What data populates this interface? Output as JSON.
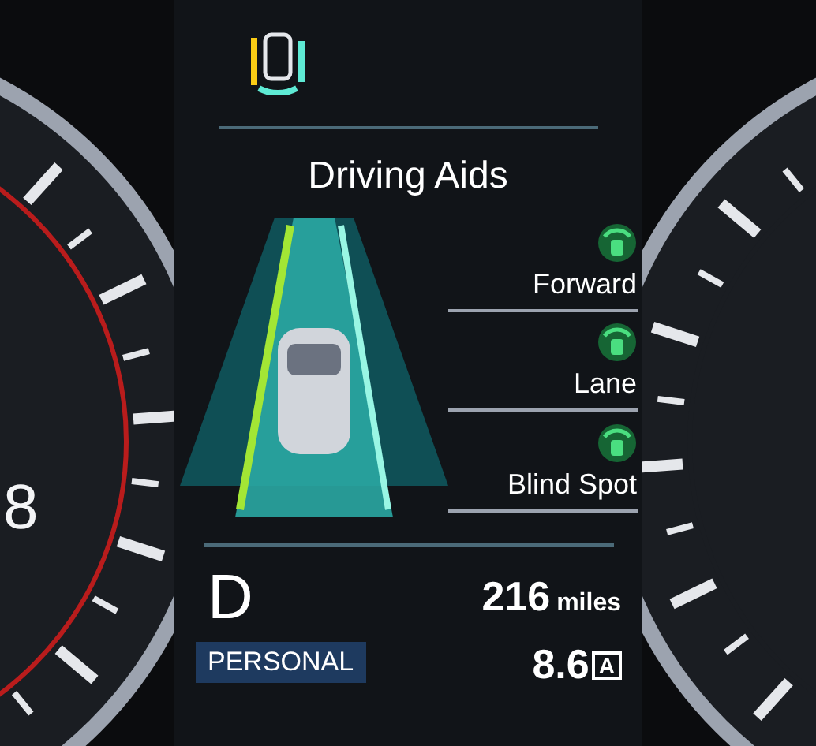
{
  "left_gauge": {
    "numeral": "8"
  },
  "title": "Driving Aids",
  "assists": [
    {
      "label": "Forward",
      "active": true
    },
    {
      "label": "Lane",
      "active": true
    },
    {
      "label": "Blind Spot",
      "active": true
    }
  ],
  "gear": "D",
  "drive_mode": "PERSONAL",
  "range": {
    "value": "216",
    "unit": "miles"
  },
  "economy": {
    "value": "8.6",
    "unit_mark": "A"
  }
}
